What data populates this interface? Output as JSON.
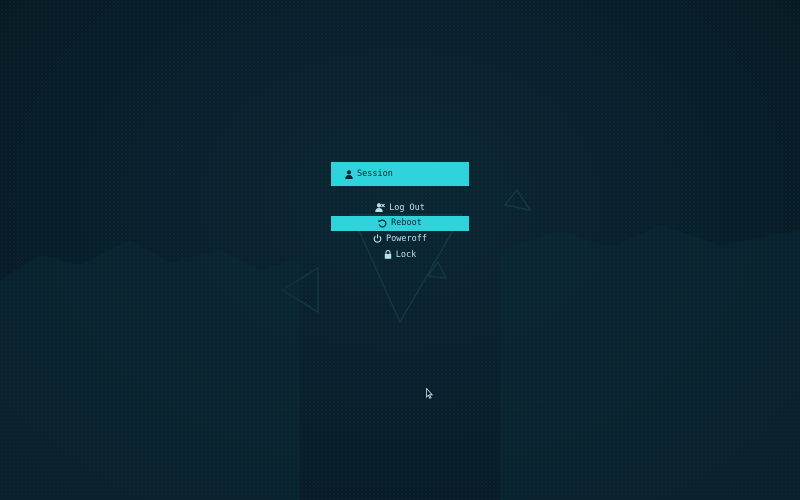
{
  "power_menu": {
    "header": {
      "label": "Session",
      "icon": "user-icon"
    },
    "items": [
      {
        "label": "Log Out",
        "icon": "user-logout-icon",
        "selected": false
      },
      {
        "label": "Reboot",
        "icon": "reboot-icon",
        "selected": true
      },
      {
        "label": "Poweroff",
        "icon": "power-icon",
        "selected": false
      },
      {
        "label": "Lock",
        "icon": "lock-icon",
        "selected": false
      }
    ]
  },
  "colors": {
    "background": "#071a24",
    "accent": "#2fd3db",
    "text": "#b9e3ea",
    "accent_text": "#0a2430"
  }
}
